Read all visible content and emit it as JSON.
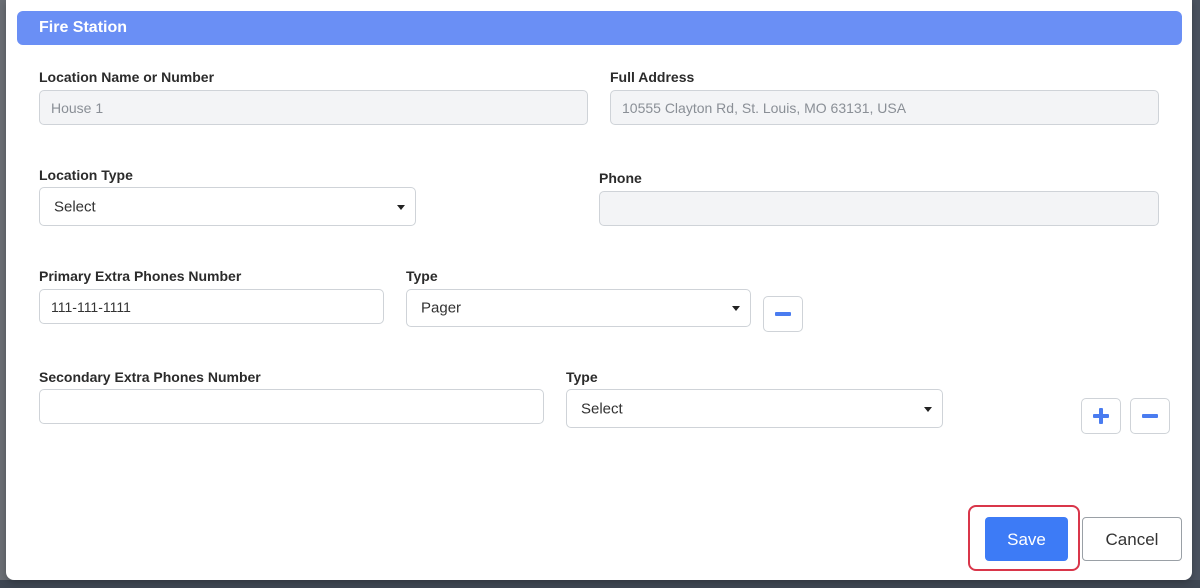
{
  "modal": {
    "title": "Fire Station"
  },
  "location_name": {
    "label": "Location Name or Number",
    "value": "House 1"
  },
  "full_address": {
    "label": "Full Address",
    "value": "10555 Clayton Rd, St. Louis, MO 63131, USA"
  },
  "location_type": {
    "label": "Location Type",
    "selected": "Select"
  },
  "phone": {
    "label": "Phone",
    "value": ""
  },
  "primary_extra_phone": {
    "label": "Primary Extra Phones Number",
    "value": "111-111-1111",
    "type_label": "Type",
    "type_selected": "Pager"
  },
  "secondary_extra_phone": {
    "label": "Secondary Extra Phones Number",
    "value": "",
    "type_label": "Type",
    "type_selected": "Select"
  },
  "buttons": {
    "save_label": "Save",
    "cancel_label": "Cancel"
  },
  "colors": {
    "header": "#6a8ff5",
    "primary": "#3d7bf6",
    "highlight": "#d9364a",
    "icon_blue": "#4a7cf0"
  },
  "icons": {
    "add": "plus-icon",
    "remove": "minus-icon",
    "dropdown": "chevron-down-icon"
  }
}
